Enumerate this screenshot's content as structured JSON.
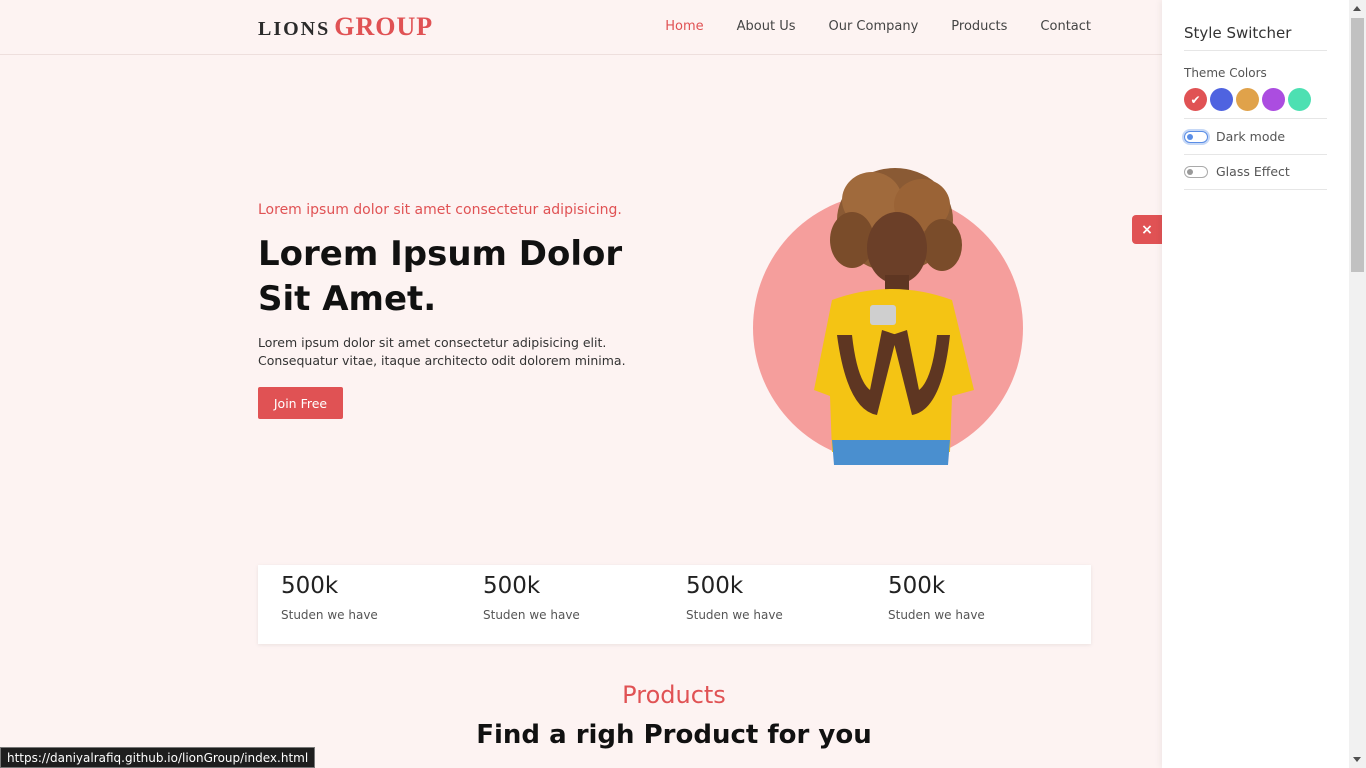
{
  "header": {
    "logo_part1": "LIONS",
    "logo_part2": "GROUP",
    "nav": [
      "Home",
      "About Us",
      "Our Company",
      "Products",
      "Contact"
    ]
  },
  "hero": {
    "subtitle": "Lorem ipsum dolor sit amet consectetur adipisicing.",
    "title": "Lorem Ipsum Dolor Sit Amet.",
    "description": "Lorem ipsum dolor sit amet consectetur adipisicing elit. Consequatur vitae, itaque architecto odit dolorem minima.",
    "button": "Join Free"
  },
  "stats": [
    {
      "value": "500k",
      "label": "Studen we have"
    },
    {
      "value": "500k",
      "label": "Studen we have"
    },
    {
      "value": "500k",
      "label": "Studen we have"
    },
    {
      "value": "500k",
      "label": "Studen we have"
    }
  ],
  "products": {
    "subtitle": "Products",
    "title": "Find a righ Product for you"
  },
  "switcher": {
    "title": "Style Switcher",
    "theme_label": "Theme Colors",
    "colors": [
      "#e05254",
      "#4f63e0",
      "#e0a24a",
      "#ab4de0",
      "#4de0b2"
    ],
    "dark_mode": "Dark mode",
    "glass": "Glass Effect",
    "close": "×"
  },
  "status_url": "https://daniyalrafiq.github.io/lionGroup/index.html"
}
